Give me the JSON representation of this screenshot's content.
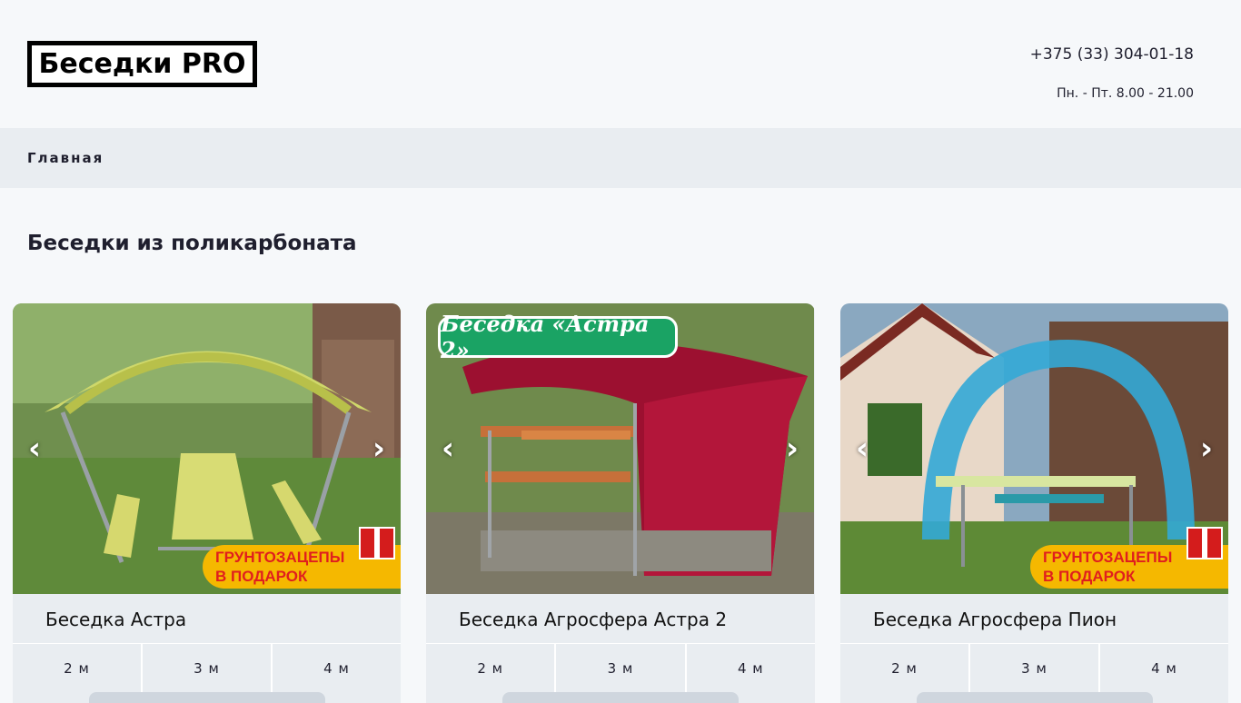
{
  "header": {
    "logo_text": "Беседки PRO",
    "phone": "+375 (33) 304-01-18",
    "hours": "Пн. - Пт. 8.00 - 21.00"
  },
  "nav": {
    "home": "Главная"
  },
  "section": {
    "title": "Беседки из поликарбоната"
  },
  "cards": [
    {
      "title": "Беседка Астра",
      "sizes": [
        "2 м",
        "3 м",
        "4 м"
      ],
      "promo": [
        "ГРУНТОЗАЦЕПЫ",
        "В ПОДАРОК"
      ]
    },
    {
      "title": "Беседка Агросфера Астра 2",
      "sizes": [
        "2 м",
        "3 м",
        "4 м"
      ],
      "badge": "Беседка «Астра 2»"
    },
    {
      "title": "Беседка Агросфера Пион",
      "sizes": [
        "2 м",
        "3 м",
        "4 м"
      ],
      "promo": [
        "ГРУНТОЗАЦЕПЫ",
        "В ПОДАРОК"
      ]
    }
  ],
  "colors": {
    "page_bg": "#f6f8fa",
    "nav_bg": "#e9edf1",
    "promo_bg": "#f5b800",
    "promo_text": "#e01e1e",
    "badge_green": "#1aa364"
  },
  "icons": {
    "prev": "chevron-left-icon",
    "next": "chevron-right-icon",
    "gift": "gift-icon"
  }
}
